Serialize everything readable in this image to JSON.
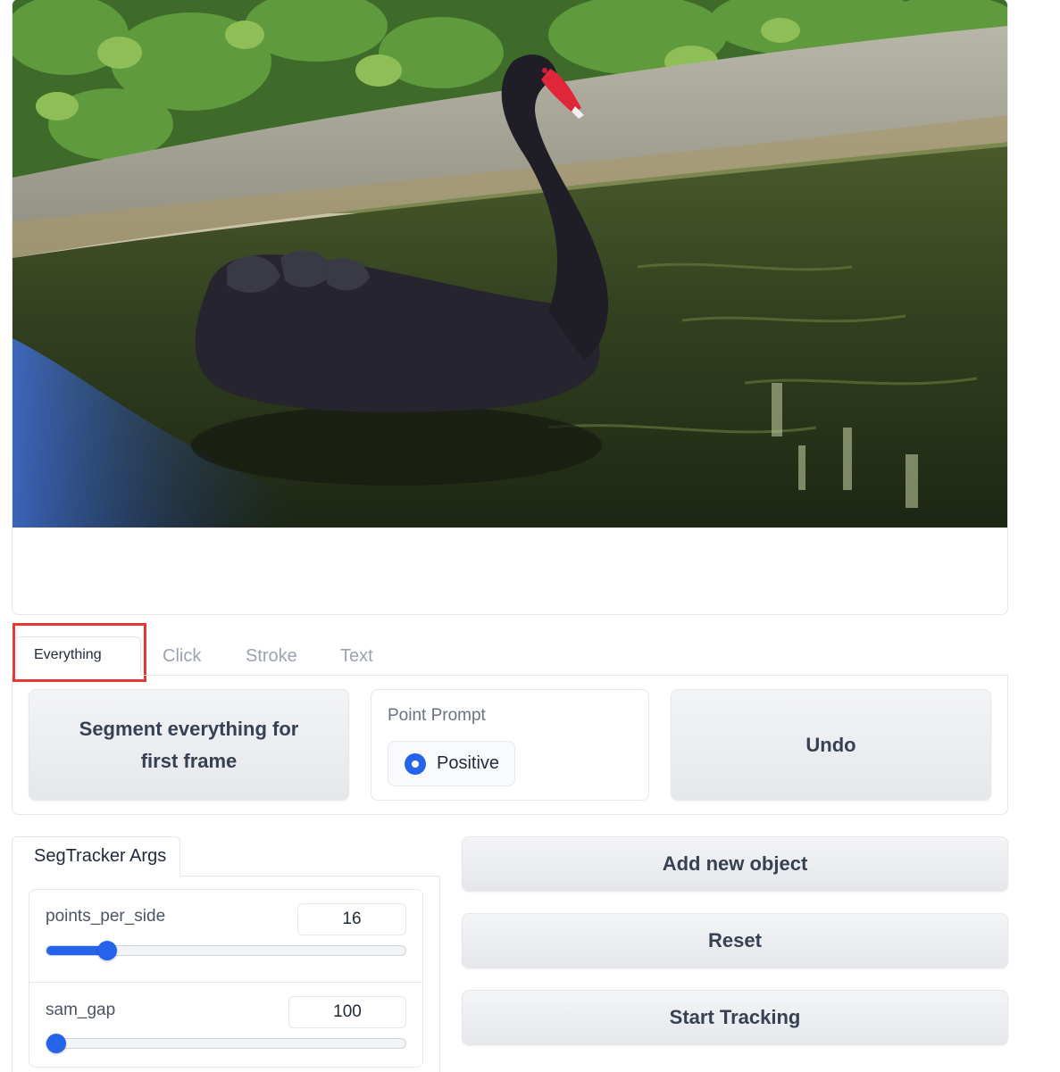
{
  "tabs": [
    "Everything",
    "Click",
    "Stroke",
    "Text"
  ],
  "everything_tab": {
    "segment_button": "Segment everything for first frame",
    "point_prompt_label": "Point Prompt",
    "positive_option": "Positive",
    "undo_button": "Undo"
  },
  "args": {
    "tab_label": "SegTracker Args",
    "sliders": [
      {
        "label": "points_per_side",
        "value": "16",
        "fraction": 0.17
      },
      {
        "label": "sam_gap",
        "value": "100",
        "fraction": 0.03
      }
    ]
  },
  "actions": {
    "add_object": "Add new object",
    "reset": "Reset",
    "start_tracking": "Start Tracking"
  },
  "colors": {
    "accent": "#2563eb",
    "highlight": "#e53935"
  }
}
